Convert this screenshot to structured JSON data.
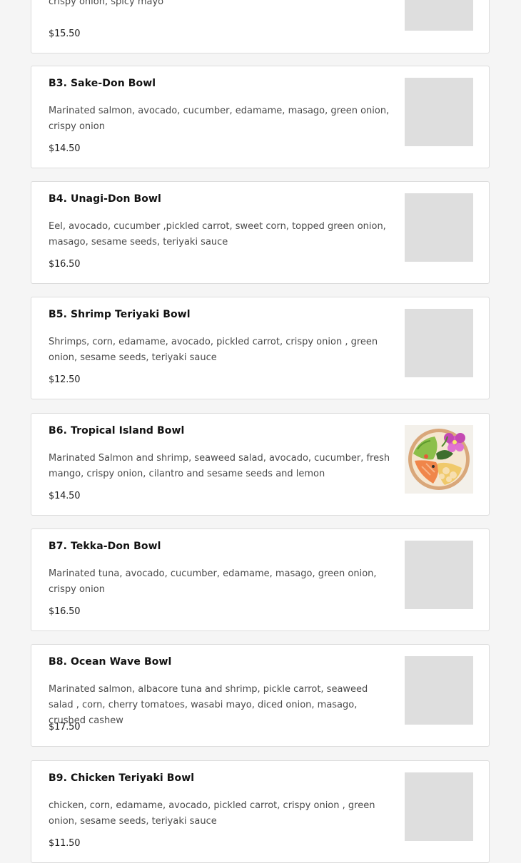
{
  "menu": {
    "items": [
      {
        "name": "",
        "description": "crispy onion, spicy mayo",
        "price": "$15.50",
        "image": "placeholder"
      },
      {
        "name": "B3. Sake-Don Bowl",
        "description": "Marinated salmon, avocado, cucumber, edamame, masago, green onion, crispy onion",
        "price": "$14.50",
        "image": "placeholder"
      },
      {
        "name": "B4. Unagi-Don Bowl",
        "description": "Eel, avocado, cucumber ,pickled carrot, sweet corn, topped green onion, masago, sesame seeds, teriyaki sauce",
        "price": "$16.50",
        "image": "placeholder"
      },
      {
        "name": "B5. Shrimp Teriyaki Bowl",
        "description": "Shrimps, corn, edamame, avocado, pickled carrot, crispy onion , green onion, sesame seeds, teriyaki sauce",
        "price": "$12.50",
        "image": "placeholder"
      },
      {
        "name": "B6. Tropical Island Bowl",
        "description": "Marinated Salmon and shrimp, seaweed salad, avocado, cucumber, fresh mango, crispy onion, cilantro and sesame seeds and lemon",
        "price": "$14.50",
        "image": "poke-bowl-photo"
      },
      {
        "name": "B7. Tekka-Don Bowl",
        "description": "Marinated tuna, avocado, cucumber, edamame, masago, green onion, crispy onion",
        "price": "$16.50",
        "image": "placeholder"
      },
      {
        "name": "B8. Ocean Wave Bowl",
        "description": "Marinated salmon, albacore tuna and shrimp, pickle carrot, seaweed salad , corn, cherry tomatoes, wasabi mayo, diced onion, masago, crushed cashew",
        "price": "$17.50",
        "image": "placeholder"
      },
      {
        "name": "B9. Chicken Teriyaki Bowl",
        "description": "chicken, corn, edamame, avocado, pickled carrot, crispy onion , green onion, sesame seeds, teriyaki sauce",
        "price": "$11.50",
        "image": "placeholder"
      }
    ]
  }
}
